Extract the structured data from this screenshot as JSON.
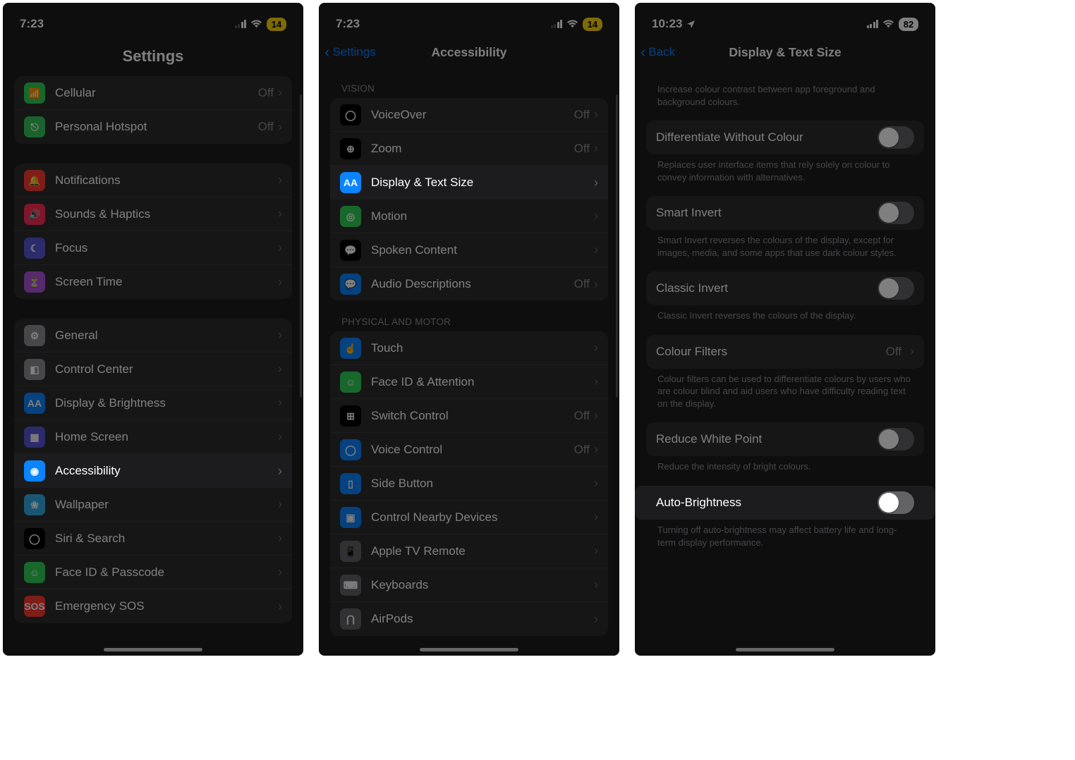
{
  "screen1": {
    "status_time": "7:23",
    "battery": "14",
    "title": "Settings",
    "groups": [
      [
        {
          "icon": "cellular-icon",
          "bg": "bg-green",
          "glyph": "📶",
          "label": "Cellular",
          "value": "Off"
        },
        {
          "icon": "hotspot-icon",
          "bg": "bg-green2",
          "glyph": "⎋",
          "label": "Personal Hotspot",
          "value": "Off"
        }
      ],
      [
        {
          "icon": "notifications-icon",
          "bg": "bg-red",
          "glyph": "🔔",
          "label": "Notifications",
          "value": ""
        },
        {
          "icon": "sounds-icon",
          "bg": "bg-pink",
          "glyph": "🔊",
          "label": "Sounds & Haptics",
          "value": ""
        },
        {
          "icon": "focus-icon",
          "bg": "bg-indigo",
          "glyph": "☾",
          "label": "Focus",
          "value": ""
        },
        {
          "icon": "screentime-icon",
          "bg": "bg-purple2",
          "glyph": "⏳",
          "label": "Screen Time",
          "value": ""
        }
      ],
      [
        {
          "icon": "general-icon",
          "bg": "bg-grey",
          "glyph": "⚙",
          "label": "General",
          "value": ""
        },
        {
          "icon": "controlcenter-icon",
          "bg": "bg-grey",
          "glyph": "◧",
          "label": "Control Center",
          "value": ""
        },
        {
          "icon": "display-icon",
          "bg": "bg-blue",
          "glyph": "AA",
          "label": "Display & Brightness",
          "value": ""
        },
        {
          "icon": "homescreen-icon",
          "bg": "bg-indigo",
          "glyph": "▦",
          "label": "Home Screen",
          "value": ""
        },
        {
          "icon": "accessibility-icon",
          "bg": "bg-blue",
          "glyph": "◉",
          "label": "Accessibility",
          "value": "",
          "highlight": true
        },
        {
          "icon": "wallpaper-icon",
          "bg": "bg-cyan",
          "glyph": "❀",
          "label": "Wallpaper",
          "value": ""
        },
        {
          "icon": "siri-icon",
          "bg": "bg-black",
          "glyph": "◯",
          "label": "Siri & Search",
          "value": ""
        },
        {
          "icon": "faceid-icon",
          "bg": "bg-green",
          "glyph": "☺",
          "label": "Face ID & Passcode",
          "value": ""
        },
        {
          "icon": "sos-icon",
          "bg": "bg-red",
          "glyph": "SOS",
          "label": "Emergency SOS",
          "value": ""
        }
      ]
    ]
  },
  "screen2": {
    "status_time": "7:23",
    "battery": "14",
    "back_label": "Settings",
    "title": "Accessibility",
    "sections": [
      {
        "header": "VISION",
        "rows": [
          {
            "icon": "voiceover-icon",
            "bg": "bg-black",
            "glyph": "◯",
            "label": "VoiceOver",
            "value": "Off"
          },
          {
            "icon": "zoom-icon",
            "bg": "bg-black",
            "glyph": "⊕",
            "label": "Zoom",
            "value": "Off"
          },
          {
            "icon": "textsize-icon",
            "bg": "bg-blue",
            "glyph": "AA",
            "label": "Display & Text Size",
            "value": "",
            "highlight": true
          },
          {
            "icon": "motion-icon",
            "bg": "bg-green",
            "glyph": "◎",
            "label": "Motion",
            "value": ""
          },
          {
            "icon": "spoken-icon",
            "bg": "bg-black",
            "glyph": "💬",
            "label": "Spoken Content",
            "value": ""
          },
          {
            "icon": "audiodesc-icon",
            "bg": "bg-blue",
            "glyph": "💬",
            "label": "Audio Descriptions",
            "value": "Off"
          }
        ]
      },
      {
        "header": "PHYSICAL AND MOTOR",
        "rows": [
          {
            "icon": "touch-icon",
            "bg": "bg-blue",
            "glyph": "☝",
            "label": "Touch",
            "value": ""
          },
          {
            "icon": "faceatt-icon",
            "bg": "bg-green",
            "glyph": "☺",
            "label": "Face ID & Attention",
            "value": ""
          },
          {
            "icon": "switch-icon",
            "bg": "bg-black",
            "glyph": "⊞",
            "label": "Switch Control",
            "value": "Off"
          },
          {
            "icon": "voicectrl-icon",
            "bg": "bg-blue",
            "glyph": "◯",
            "label": "Voice Control",
            "value": "Off"
          },
          {
            "icon": "sidebtn-icon",
            "bg": "bg-blue",
            "glyph": "▯",
            "label": "Side Button",
            "value": ""
          },
          {
            "icon": "nearby-icon",
            "bg": "bg-blue",
            "glyph": "▣",
            "label": "Control Nearby Devices",
            "value": ""
          },
          {
            "icon": "appletv-icon",
            "bg": "bg-dkgrey",
            "glyph": "📱",
            "label": "Apple TV Remote",
            "value": ""
          },
          {
            "icon": "keyboards-icon",
            "bg": "bg-dkgrey",
            "glyph": "⌨",
            "label": "Keyboards",
            "value": ""
          },
          {
            "icon": "airpods-icon",
            "bg": "bg-dkgrey",
            "glyph": "⋂",
            "label": "AirPods",
            "value": ""
          }
        ]
      }
    ]
  },
  "screen3": {
    "status_time": "10:23",
    "battery": "82",
    "back_label": "Back",
    "title": "Display & Text Size",
    "top_footer": "Increase colour contrast between app foreground and background colours.",
    "items": [
      {
        "type": "toggle",
        "label": "Differentiate Without Colour",
        "on": false,
        "footer": "Replaces user interface items that rely solely on colour to convey information with alternatives."
      },
      {
        "type": "toggle",
        "label": "Smart Invert",
        "on": false,
        "footer": "Smart Invert reverses the colours of the display, except for images, media, and some apps that use dark colour styles."
      },
      {
        "type": "toggle",
        "label": "Classic Invert",
        "on": false,
        "footer": "Classic Invert reverses the colours of the display."
      },
      {
        "type": "nav",
        "label": "Colour Filters",
        "value": "Off",
        "footer": "Colour filters can be used to differentiate colours by users who are colour blind and aid users who have difficulty reading text on the display."
      },
      {
        "type": "toggle",
        "label": "Reduce White Point",
        "on": false,
        "footer": "Reduce the intensity of bright colours."
      },
      {
        "type": "toggle",
        "label": "Auto-Brightness",
        "on": false,
        "highlight": true,
        "footer": "Turning off auto-brightness may affect battery life and long-term display performance."
      }
    ]
  }
}
